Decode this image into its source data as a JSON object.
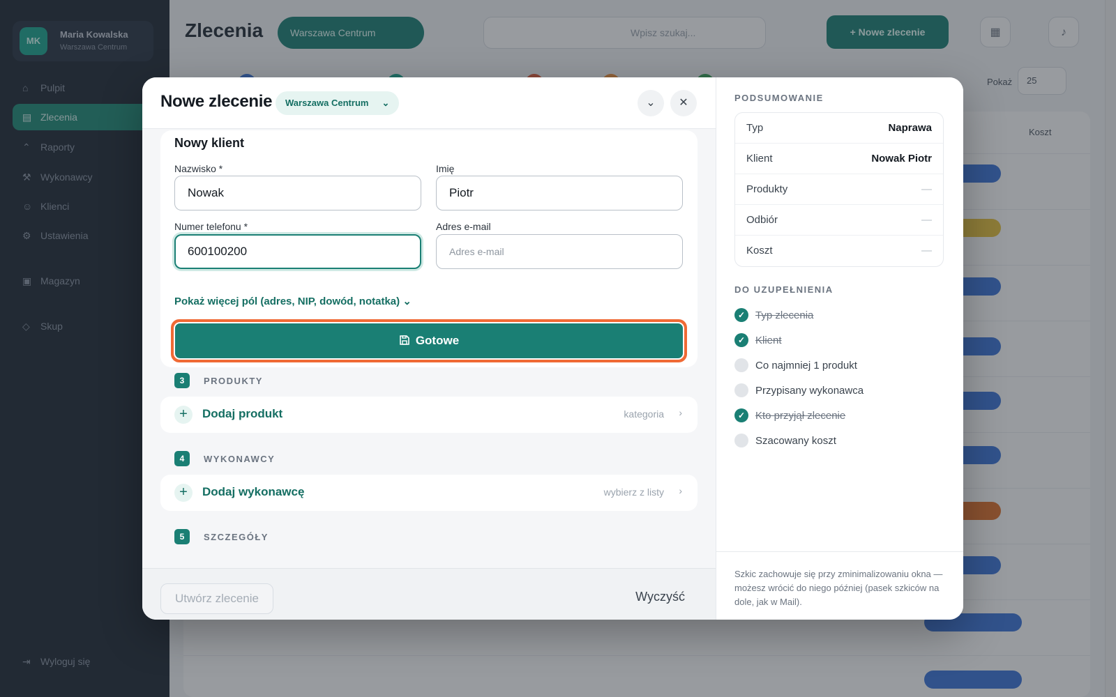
{
  "background": {
    "sidebar": {
      "user_initials": "MK",
      "user_name": "Maria Kowalska",
      "user_role": "Warszawa Centrum",
      "items": [
        {
          "label": "Pulpit",
          "icon": "home-icon"
        },
        {
          "label": "Zlecenia",
          "icon": "clipboard-icon"
        },
        {
          "label": "Raporty",
          "icon": "chart-icon"
        },
        {
          "label": "Wykonawcy",
          "icon": "wrench-icon"
        },
        {
          "label": "Klienci",
          "icon": "users-icon"
        },
        {
          "label": "Ustawienia",
          "icon": "gear-icon"
        },
        {
          "label": "Magazyn",
          "icon": "box-icon"
        },
        {
          "label": "Skup",
          "icon": "tag-icon"
        }
      ],
      "logout_label": "Wyloguj się"
    },
    "header": {
      "title": "Zlecenia",
      "branch": "Warszawa Centrum",
      "search_placeholder": "Wpisz szukaj...",
      "new_order_label": "+ Nowe zlecenie"
    },
    "per_page_label": "Pokaż",
    "per_page_value": "25",
    "column_cost": "Koszt"
  },
  "modal": {
    "title": "Nowe zlecenie",
    "branch": "Warszawa Centrum",
    "client_card": {
      "title": "Nowy klient",
      "surname_label": "Nazwisko *",
      "surname_value": "Nowak",
      "name_label": "Imię",
      "name_value": "Piotr",
      "phone_label": "Numer telefonu *",
      "phone_value": "600100200",
      "email_label": "Adres e-mail",
      "email_placeholder": "Adres e-mail",
      "more_label": "Pokaż więcej pól (adres, NIP, dowód, notatka)",
      "done_label": "Gotowe"
    },
    "sections": [
      {
        "num": "3",
        "label": "PRODUKTY",
        "add_label": "Dodaj produkt",
        "hint": "kategoria"
      },
      {
        "num": "4",
        "label": "WYKONAWCY",
        "add_label": "Dodaj wykonawcę",
        "hint": "wybierz z listy"
      },
      {
        "num": "5",
        "label": "SZCZEGÓŁY"
      }
    ],
    "footer": {
      "create_label": "Utwórz zlecenie",
      "clear_label": "Wyczyść"
    },
    "summary": {
      "heading": "PODSUMOWANIE",
      "rows": [
        {
          "key": "Typ",
          "value": "Naprawa"
        },
        {
          "key": "Klient",
          "value": "Nowak Piotr"
        },
        {
          "key": "Produkty",
          "value": "—"
        },
        {
          "key": "Odbiór",
          "value": "—"
        },
        {
          "key": "Koszt",
          "value": "—"
        }
      ]
    },
    "todo": {
      "heading": "DO UZUPEŁNIENIA",
      "items": [
        {
          "label": "Typ zlecenia",
          "done": true
        },
        {
          "label": "Klient",
          "done": true
        },
        {
          "label": "Co najmniej 1 produkt",
          "done": false
        },
        {
          "label": "Przypisany wykonawca",
          "done": false
        },
        {
          "label": "Kto przyjął zlecenie",
          "done": true
        },
        {
          "label": "Szacowany koszt",
          "done": false
        }
      ]
    },
    "draft_note": "Szkic zachowuje się przy zminimalizowaniu okna — możesz wrócić do niego później (pasek szkiców na dole, jak w Mail).",
    "colors": {
      "accent": "#1a7f74",
      "highlight_ring": "#f06a35"
    }
  }
}
